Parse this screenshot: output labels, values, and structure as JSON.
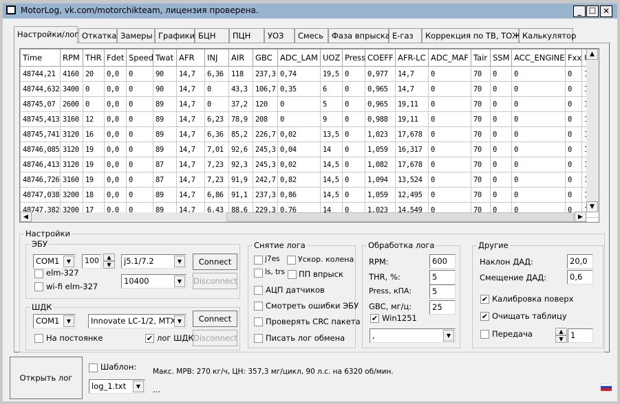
{
  "window": {
    "title": "MotorLog, vk.com/motorchikteam, лицензия проверена.",
    "minimize": "_",
    "maximize": "☐",
    "close": "✕"
  },
  "tabs": [
    "Настройки/лог",
    "Откатка",
    "Замеры",
    "Графики",
    "БЦН",
    "ПЦН",
    "УОЗ",
    "Смесь",
    "Фаза впрыска",
    "E-газ",
    "Коррекция по ТВ, ТОЖ",
    "Калькулятор"
  ],
  "table": {
    "columns": [
      "Time",
      "RPM",
      "THR",
      "Fdet",
      "Speed",
      "Twat",
      "AFR",
      "INJ",
      "AIR",
      "GBC",
      "ADC_LAM",
      "UOZ",
      "Press",
      "COEFF",
      "AFR-LC",
      "ADC_MAF",
      "Tair",
      "SSM",
      "ACC_ENGINE",
      "Fxx",
      "U"
    ],
    "rows": [
      [
        "48744,21",
        "4160",
        "20",
        "0,0",
        "0",
        "90",
        "14,7",
        "6,36",
        "118",
        "237,3",
        "0,74",
        "19,5",
        "0",
        "0,977",
        "14,7",
        "0",
        "70",
        "0",
        "0",
        "0",
        "1"
      ],
      [
        "48744,632",
        "3400",
        "0",
        "0,0",
        "0",
        "90",
        "14,7",
        "0",
        "43,3",
        "106,7",
        "0,35",
        "6",
        "0",
        "0,965",
        "14,7",
        "0",
        "70",
        "0",
        "0",
        "0",
        "1"
      ],
      [
        "48745,07",
        "2600",
        "0",
        "0,0",
        "0",
        "89",
        "14,7",
        "0",
        "37,2",
        "120",
        "0",
        "5",
        "0",
        "0,965",
        "19,11",
        "0",
        "70",
        "0",
        "0",
        "0",
        "1"
      ],
      [
        "48745,413",
        "3160",
        "12",
        "0,0",
        "0",
        "89",
        "14,7",
        "6,23",
        "78,9",
        "208",
        "0",
        "9",
        "0",
        "0,988",
        "19,11",
        "0",
        "70",
        "0",
        "0",
        "0",
        "1"
      ],
      [
        "48745,741",
        "3120",
        "16",
        "0,0",
        "0",
        "89",
        "14,7",
        "6,36",
        "85,2",
        "226,7",
        "0,02",
        "13,5",
        "0",
        "1,023",
        "17,678",
        "0",
        "70",
        "0",
        "0",
        "0",
        "1"
      ],
      [
        "48746,085",
        "3120",
        "19",
        "0,0",
        "0",
        "89",
        "14,7",
        "7,01",
        "92,6",
        "245,3",
        "0,04",
        "14",
        "0",
        "1,059",
        "16,317",
        "0",
        "70",
        "0",
        "0",
        "0",
        "1"
      ],
      [
        "48746,413",
        "3120",
        "19",
        "0,0",
        "0",
        "87",
        "14,7",
        "7,23",
        "92,3",
        "245,3",
        "0,02",
        "14,5",
        "0",
        "1,082",
        "17,678",
        "0",
        "70",
        "0",
        "0",
        "0",
        "1"
      ],
      [
        "48746,726",
        "3160",
        "19",
        "0,0",
        "0",
        "87",
        "14,7",
        "7,23",
        "91,9",
        "242,7",
        "0,82",
        "14,5",
        "0",
        "1,094",
        "13,524",
        "0",
        "70",
        "0",
        "0",
        "0",
        "1"
      ],
      [
        "48747,038",
        "3200",
        "18",
        "0,0",
        "0",
        "89",
        "14,7",
        "6,86",
        "91,1",
        "237,3",
        "0,86",
        "14,5",
        "0",
        "1,059",
        "12,495",
        "0",
        "70",
        "0",
        "0",
        "0",
        "1"
      ],
      [
        "48747,382",
        "3200",
        "17",
        "0,0",
        "0",
        "89",
        "14,7",
        "6,43",
        "88,6",
        "229,3",
        "0,76",
        "14",
        "0",
        "1,023",
        "14,549",
        "0",
        "70",
        "0",
        "0",
        "0",
        "1"
      ]
    ]
  },
  "settings": {
    "title": "Настройки",
    "ecu": {
      "title": "ЭБУ",
      "port": "COM1",
      "rate": "100",
      "protocol": "j5.1/7.2",
      "baud": "10400",
      "elm": "elm-327",
      "wifi_elm": "wi-fi elm-327",
      "connect": "Connect",
      "disconnect": "Disconnect"
    },
    "wbo": {
      "title": "ШДК",
      "port": "COM1",
      "device": "Innovate LC-1/2, MTX-L",
      "permanent": "На постоянке",
      "log": "лог ШДК",
      "log_checked": true,
      "connect": "Connect",
      "disconnect": "Disconnect"
    },
    "capture": {
      "title": "Снятие лога",
      "j7es": "j7es",
      "accel": "Ускор. колена",
      "ls_trs": "ls, trs",
      "pp": "ПП впрыск",
      "adc": "АЦП датчиков",
      "errors": "Смотреть ошибки ЭБУ",
      "crc": "Проверять CRC пакета",
      "exchange": "Писать лог обмена"
    },
    "process": {
      "title": "Обработка лога",
      "rpm_label": "RPM:",
      "rpm": "600",
      "thr_label": "THR, %:",
      "thr": "5",
      "press_label": "Press, кПА:",
      "press": "5",
      "gbc_label": "GBC, мг/ц:",
      "gbc": "25",
      "win1251": "Win1251",
      "win1251_checked": true,
      "separator": ","
    },
    "other": {
      "title": "Другие",
      "slope_label": "Наклон ДАД:",
      "slope": "20,0",
      "offset_label": "Смещение ДАД:",
      "offset": "0,6",
      "calib": "Калибровка поверх",
      "calib_checked": true,
      "clear": "Очищать таблицу",
      "clear_checked": true,
      "gear": "Передача",
      "gear_value": "1"
    }
  },
  "bottom": {
    "open_log": "Открыть лог",
    "template": "Шаблон:",
    "file": "log_1.txt",
    "summary": "Макс. МРВ: 270 кг/ч, ЦН: 357,3 мг/цикл, 90 л.с. на 6320 об/мин.",
    "status": "..."
  },
  "colors": {
    "titlebar": "#99b4d1"
  }
}
